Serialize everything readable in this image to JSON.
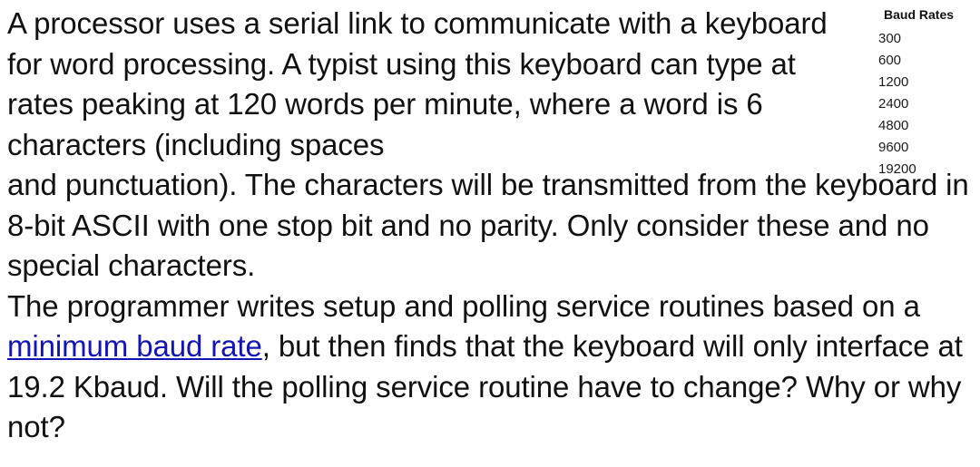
{
  "page": {
    "background_color": "#ffffff",
    "text_color": "#111111"
  },
  "baud_table": {
    "title": "Baud Rates",
    "rates": [
      "300",
      "600",
      "1200",
      "2400",
      "4800",
      "9600",
      "19200"
    ]
  },
  "question": {
    "paragraph_1_part_a": "A processor uses a serial link to communicate with a keyboard for word processing. A typist using this keyboard can type at rates peaking at 120 words per minute, where a word is 6 characters (including spaces",
    "paragraph_1_part_b": "and punctuation). The characters will be transmitted from the keyboard in 8-bit ASCII with one stop bit and no parity. Only consider these and no special characters.",
    "paragraph_2_before_link": "The programmer writes setup and polling service routines based on a ",
    "link_text": "minimum baud rate",
    "link_color": "#1414b4",
    "paragraph_2_after_link": ", but then finds that the keyboard will only interface at 19.2 Kbaud. Will the polling service routine have to change? Why or why not?"
  }
}
